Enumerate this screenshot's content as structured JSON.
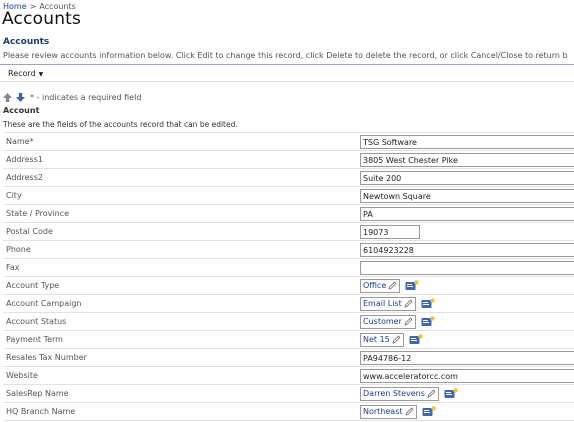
{
  "breadcrumb": {
    "home": "Home",
    "separator": ">",
    "current": "Accounts"
  },
  "page_title": "Accounts",
  "section_title": "Accounts",
  "instructions": "Please review accounts information below. Click Edit to change this record, click Delete to delete the record, or click Cancel/Close to return b",
  "toolbar": {
    "record_label": "Record"
  },
  "required_note": "* - indicates a required field",
  "account_heading": "Account",
  "account_desc": "These are the fields of the accounts record that can be edited.",
  "fields": {
    "name": {
      "label": "Name*",
      "value": "TSG Software"
    },
    "address1": {
      "label": "Address1",
      "value": "3805 West Chester Pike"
    },
    "address2": {
      "label": "Address2",
      "value": "Suite 200"
    },
    "city": {
      "label": "City",
      "value": "Newtown Square"
    },
    "state": {
      "label": "State / Province",
      "value": "PA"
    },
    "postal": {
      "label": "Postal Code",
      "value": "19073"
    },
    "phone": {
      "label": "Phone",
      "value": "6104923228"
    },
    "fax": {
      "label": "Fax",
      "value": ""
    },
    "account_type": {
      "label": "Account Type",
      "value": "Office"
    },
    "account_campaign": {
      "label": "Account Campaign",
      "value": "Email List"
    },
    "account_status": {
      "label": "Account Status",
      "value": "Customer"
    },
    "payment_term": {
      "label": "Payment Term",
      "value": "Net 15"
    },
    "resales_tax": {
      "label": "Resales Tax Number",
      "value": "PA94786-12"
    },
    "website": {
      "label": "Website",
      "value": "www.acceleratorcc.com"
    },
    "salesrep": {
      "label": "SalesRep Name",
      "value": "Darren Stevens"
    },
    "hq_branch": {
      "label": "HQ Branch Name",
      "value": "Northeast"
    }
  },
  "icons": {
    "up": "arrow-up-icon",
    "down": "arrow-down-icon",
    "edit": "pencil-icon",
    "lookup": "card-icon"
  },
  "colors": {
    "link": "#1a3e8c",
    "heading": "#1b3d6d",
    "arrow": "#7d8796"
  }
}
